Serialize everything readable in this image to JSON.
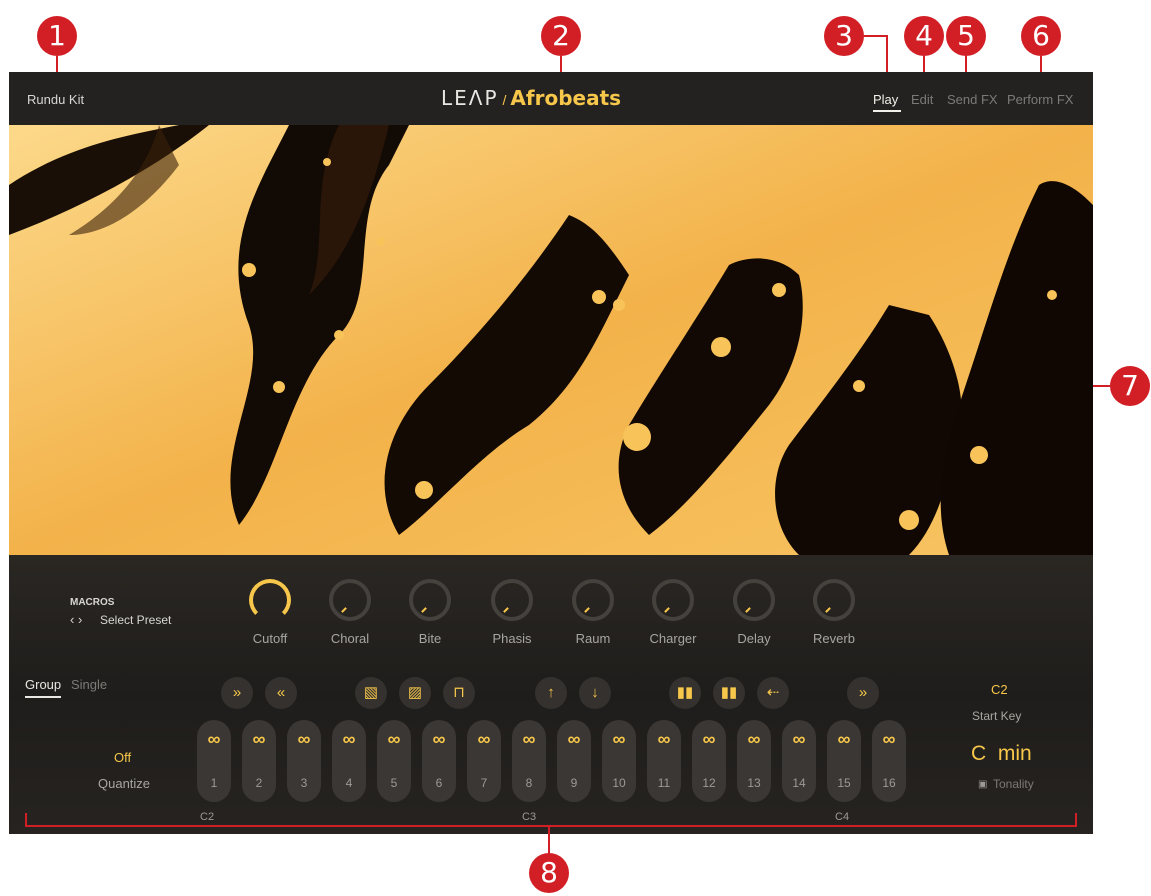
{
  "callouts": [
    "1",
    "2",
    "3",
    "4",
    "5",
    "6",
    "7",
    "8"
  ],
  "header": {
    "preset_name": "Rundu Kit",
    "logo_leap": "LEΛP",
    "logo_slash": "/",
    "logo_product": "Afrobeats",
    "tabs": [
      "Play",
      "Edit",
      "Send FX",
      "Perform FX"
    ],
    "active_tab": "Play"
  },
  "macros": {
    "title": "MACROS",
    "select_preset": "Select Preset",
    "knobs": [
      "Cutoff",
      "Choral",
      "Bite",
      "Phasis",
      "Raum",
      "Charger",
      "Delay",
      "Reverb"
    ]
  },
  "mode_tabs": [
    "Group",
    "Single"
  ],
  "quantize": {
    "value": "Off",
    "label": "Quantize"
  },
  "start_key": {
    "value": "C2",
    "label": "Start Key"
  },
  "tonality": {
    "value": "C  min",
    "label": "Tonality"
  },
  "pads": [
    "1",
    "2",
    "3",
    "4",
    "5",
    "6",
    "7",
    "8",
    "9",
    "10",
    "11",
    "12",
    "13",
    "14",
    "15",
    "16"
  ],
  "pad_icon": "∞",
  "octaves": [
    "C2",
    "C3",
    "C4"
  ],
  "colors": {
    "accent": "#f7c74b",
    "callout": "#d21f26",
    "panel": "#1d1c1b"
  },
  "icons": [
    "fast-forward-icon",
    "rewind-icon",
    "texture-icon",
    "texture-alt-icon",
    "envelope-icon",
    "arrow-up-icon",
    "arrow-down-icon",
    "bars-left-icon",
    "bars-right-icon",
    "reverse-icon",
    "fast-forward-icon"
  ]
}
